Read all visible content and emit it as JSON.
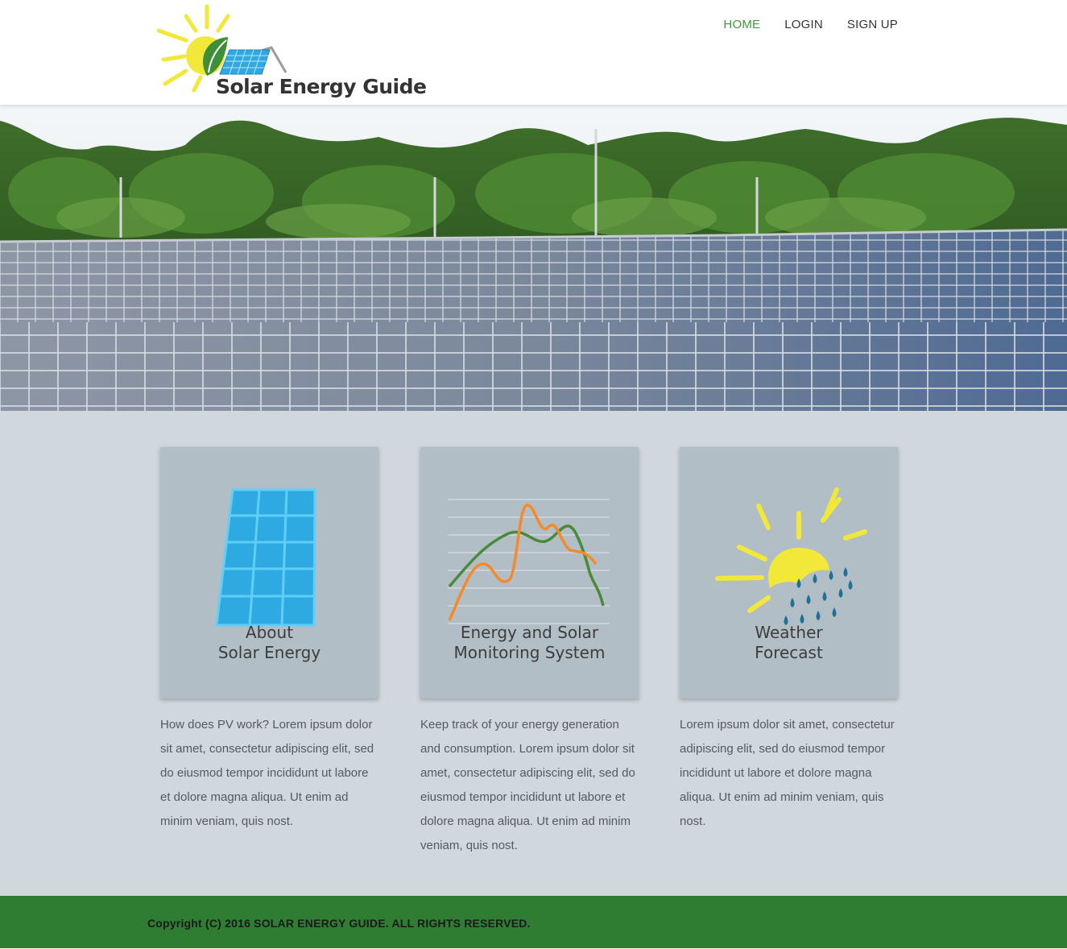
{
  "brand": {
    "name": "Solar Energy Guide",
    "colors": {
      "accent": "#3e9c3e",
      "footer": "#2e7d32",
      "section_bg": "#d0d7dd",
      "card_bg": "#b1bec5",
      "sun": "#f2e83a",
      "panel": "#2fa9e1"
    }
  },
  "nav": {
    "items": [
      {
        "label": "HOME",
        "active": true
      },
      {
        "label": "LOGIN",
        "active": false
      },
      {
        "label": "SIGN UP",
        "active": false
      }
    ]
  },
  "hero": {
    "image": "solar-farm-photo"
  },
  "features": [
    {
      "icon": "solar-panel-icon",
      "title_line1": "About",
      "title_line2": "Solar Energy",
      "description": "How does PV work? Lorem ipsum dolor sit amet, consectetur adipiscing elit, sed do eiusmod tempor incididunt ut labore et dolore magna aliqua. Ut enim ad minim veniam, quis nost."
    },
    {
      "icon": "line-chart-icon",
      "title_line1": "Energy and Solar",
      "title_line2": "Monitoring System",
      "description": "Keep track of your energy generation and consumption. Lorem ipsum dolor sit amet, consectetur adipiscing elit, sed do eiusmod tempor incididunt ut labore et dolore magna aliqua. Ut enim ad minim veniam, quis nost."
    },
    {
      "icon": "sun-rain-icon",
      "title_line1": "Weather",
      "title_line2": "Forecast",
      "description": "Lorem ipsum dolor sit amet, consectetur adipiscing elit, sed do eiusmod tempor incididunt ut labore et dolore magna aliqua. Ut enim ad minim veniam, quis nost."
    }
  ],
  "footer": {
    "copyright": "Copyright (C) 2016 SOLAR ENERGY GUIDE. ALL RIGHTS RESERVED."
  }
}
